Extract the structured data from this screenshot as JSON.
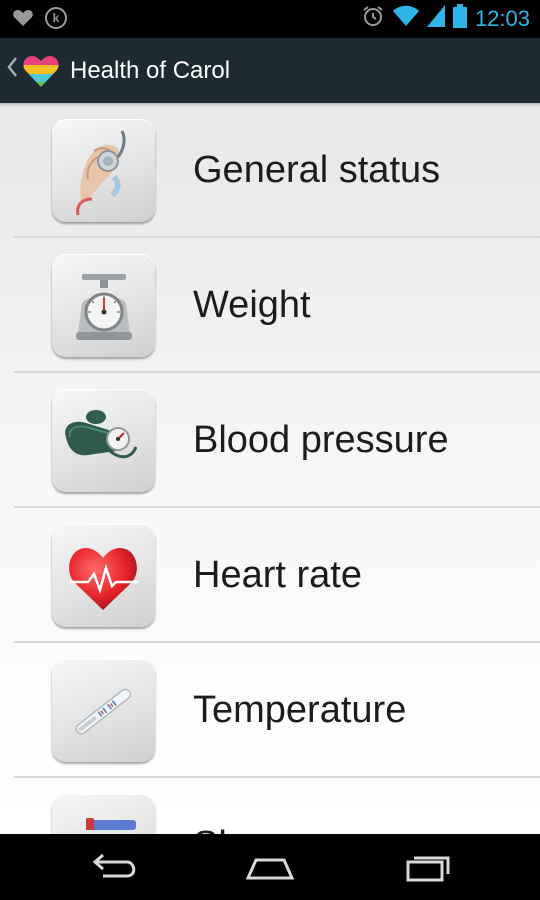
{
  "status_bar": {
    "time": "12:03",
    "left_icons": [
      "app-heart-icon",
      "kik-icon"
    ],
    "right_icons": [
      "alarm-icon",
      "wifi-icon",
      "cell-signal-icon",
      "battery-icon"
    ]
  },
  "action_bar": {
    "title": "Health of Carol",
    "up_icon": "chevron-left-icon",
    "logo_icon": "heart-logo-icon"
  },
  "menu": {
    "items": [
      {
        "label": "General status",
        "icon": "stethoscope-hand-icon"
      },
      {
        "label": "Weight",
        "icon": "kitchen-scale-icon"
      },
      {
        "label": "Blood pressure",
        "icon": "blood-pressure-cuff-icon"
      },
      {
        "label": "Heart rate",
        "icon": "heart-pulse-icon"
      },
      {
        "label": "Temperature",
        "icon": "thermometer-icon"
      },
      {
        "label": "Sl",
        "icon": "medication-icon"
      }
    ]
  },
  "nav_bar": {
    "buttons": [
      "back-icon",
      "home-icon",
      "recent-apps-icon"
    ]
  },
  "colors": {
    "status_accent": "#2fb4e8",
    "action_bar_bg": "#1e2a31",
    "heart_red": "#e8262b"
  }
}
